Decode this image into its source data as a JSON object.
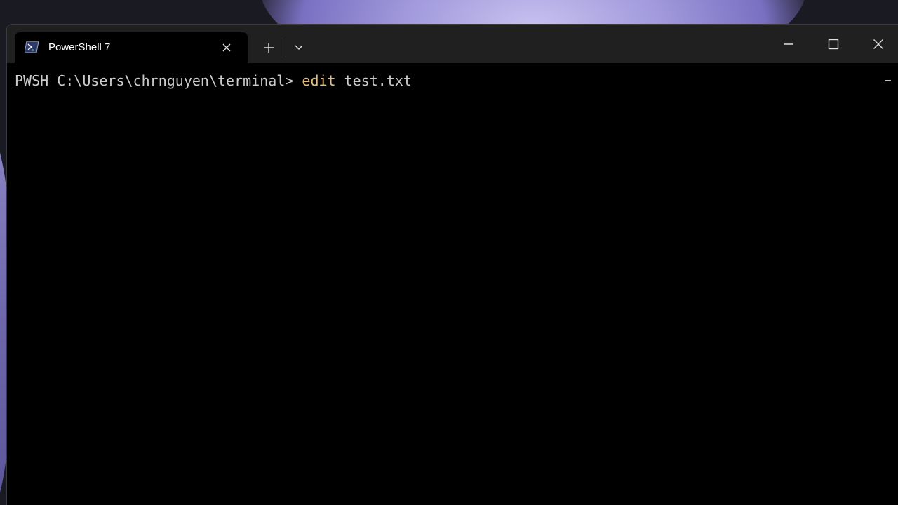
{
  "window": {
    "tab": {
      "title": "PowerShell 7",
      "icon": "powershell-icon",
      "close_icon": "close-icon"
    },
    "new_tab_icon": "plus-icon",
    "dropdown_icon": "chevron-down-icon",
    "caption_buttons": [
      "minimize-icon",
      "maximize-icon",
      "close-icon"
    ]
  },
  "terminal": {
    "prompt": "PWSH C:\\Users\\chrnguyen\\terminal> ",
    "command": "edit",
    "argument": " test.txt"
  },
  "colors": {
    "terminal_bg": "#000000",
    "titlebar_bg": "#202020",
    "command_color": "#e5c07b",
    "text_color": "#cccccc",
    "powershell_blue": "#2b3a67"
  }
}
